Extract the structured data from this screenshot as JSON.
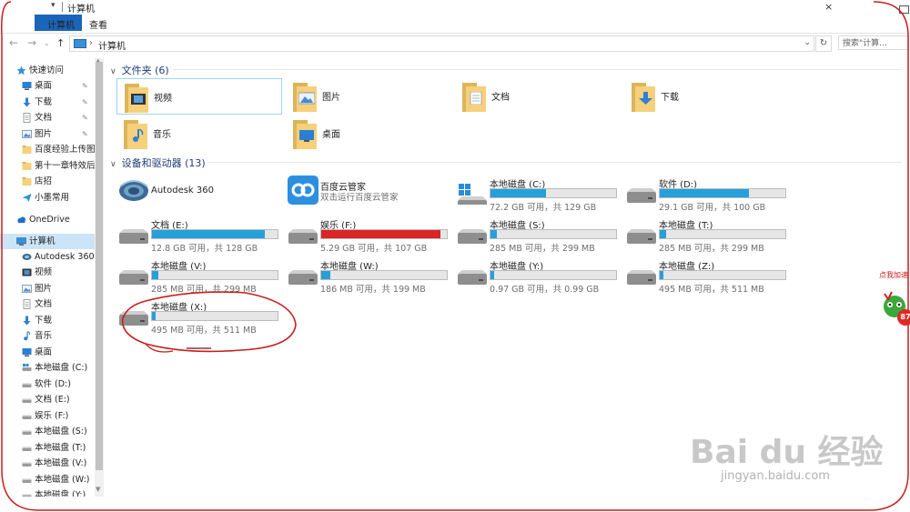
{
  "window": {
    "title": "计算机",
    "qa_arrow": "▾",
    "close_glyph": "×"
  },
  "ribbon": {
    "tabs": [
      "计算机",
      "查看"
    ]
  },
  "address": {
    "path": "计算机",
    "search_placeholder": "搜索\"计算..."
  },
  "nav": {
    "items": [
      {
        "label": "快速访问",
        "icon": "star-icon",
        "pinned": false
      },
      {
        "label": "桌面",
        "icon": "desktop-icon",
        "pinned": true
      },
      {
        "label": "下载",
        "icon": "download-arrow-icon",
        "pinned": true
      },
      {
        "label": "文档",
        "icon": "document-icon",
        "pinned": true
      },
      {
        "label": "图片",
        "icon": "picture-icon",
        "pinned": true
      },
      {
        "label": "百度经验上传图...",
        "icon": "folder-icon",
        "pinned": false
      },
      {
        "label": "第十一章特效后...",
        "icon": "folder-icon",
        "pinned": false
      },
      {
        "label": "店招",
        "icon": "folder-icon",
        "pinned": false
      },
      {
        "label": "小墨常用",
        "icon": "send-icon",
        "pinned": false
      },
      {
        "label": "OneDrive",
        "icon": "cloud-icon",
        "pinned": false
      },
      {
        "label": "计算机",
        "icon": "computer-icon",
        "pinned": false
      },
      {
        "label": "Autodesk 360",
        "icon": "autodesk-icon",
        "pinned": false
      },
      {
        "label": "视频",
        "icon": "video-icon",
        "pinned": false
      },
      {
        "label": "图片",
        "icon": "picture-icon",
        "pinned": false
      },
      {
        "label": "文档",
        "icon": "document-icon",
        "pinned": false
      },
      {
        "label": "下载",
        "icon": "download-arrow-icon",
        "pinned": false
      },
      {
        "label": "音乐",
        "icon": "music-note-icon",
        "pinned": false
      },
      {
        "label": "桌面",
        "icon": "desktop-icon",
        "pinned": false
      },
      {
        "label": "本地磁盘 (C:)",
        "icon": "windows-drive-icon",
        "pinned": false
      },
      {
        "label": "软件 (D:)",
        "icon": "drive-icon",
        "pinned": false
      },
      {
        "label": "文档 (E:)",
        "icon": "drive-icon",
        "pinned": false
      },
      {
        "label": "娱乐 (F:)",
        "icon": "drive-icon",
        "pinned": false
      },
      {
        "label": "本地磁盘 (S:)",
        "icon": "drive-icon",
        "pinned": false
      },
      {
        "label": "本地磁盘 (T:)",
        "icon": "drive-icon",
        "pinned": false
      },
      {
        "label": "本地磁盘 (V:)",
        "icon": "drive-icon",
        "pinned": false
      },
      {
        "label": "本地磁盘 (W:)",
        "icon": "drive-icon",
        "pinned": false
      },
      {
        "label": "本地磁盘 (Y:)",
        "icon": "drive-icon",
        "pinned": false
      }
    ],
    "pin_glyph": "✎"
  },
  "folders_group": {
    "header": "文件夹 (6)",
    "items": [
      "视频",
      "图片",
      "文档",
      "下载",
      "音乐",
      "桌面"
    ]
  },
  "devices_group": {
    "header": "设备和驱动器 (13)",
    "apps": [
      {
        "name": "Autodesk 360",
        "sub": ""
      },
      {
        "name": "百度云管家",
        "sub": "双击运行百度云管家"
      }
    ],
    "drives": [
      {
        "name": "本地磁盘 (C:)",
        "info": "72.2 GB 可用，共 129 GB",
        "used_fraction": 0.44,
        "color": "#26a0da",
        "windows": true
      },
      {
        "name": "软件 (D:)",
        "info": "29.1 GB 可用，共 100 GB",
        "used_fraction": 0.71,
        "color": "#26a0da"
      },
      {
        "name": "文档 (E:)",
        "info": "12.8 GB 可用，共 128 GB",
        "used_fraction": 0.9,
        "color": "#26a0da"
      },
      {
        "name": "娱乐 (F:)",
        "info": "5.29 GB 可用，共 107 GB",
        "used_fraction": 0.95,
        "color": "#da2626"
      },
      {
        "name": "本地磁盘 (S:)",
        "info": "285 MB 可用，共 299 MB",
        "used_fraction": 0.05,
        "color": "#26a0da"
      },
      {
        "name": "本地磁盘 (T:)",
        "info": "285 MB 可用，共 299 MB",
        "used_fraction": 0.05,
        "color": "#26a0da"
      },
      {
        "name": "本地磁盘 (V:)",
        "info": "285 MB 可用，共 299 MB",
        "used_fraction": 0.05,
        "color": "#26a0da"
      },
      {
        "name": "本地磁盘 (W:)",
        "info": "186 MB 可用，共 199 MB",
        "used_fraction": 0.07,
        "color": "#26a0da"
      },
      {
        "name": "本地磁盘 (Y:)",
        "info": "0.97 GB 可用，共 0.99 GB",
        "used_fraction": 0.03,
        "color": "#26a0da"
      },
      {
        "name": "本地磁盘 (Z:)",
        "info": "495 MB 可用，共 511 MB",
        "used_fraction": 0.03,
        "color": "#26a0da"
      },
      {
        "name": "本地磁盘 (X:)",
        "info": "495 MB 可用，共 511 MB",
        "used_fraction": 0.03,
        "color": "#26a0da"
      }
    ]
  },
  "overlay": {
    "watermark_main": "Bai du 经验",
    "watermark_url": "jingyan.baidu.com",
    "ad_label": "点我加速",
    "ad_number": "87"
  },
  "colors": {
    "accent": "#1a65b8",
    "bar_normal": "#26a0da",
    "bar_full": "#da2626",
    "annotation": "#c81e1e"
  }
}
